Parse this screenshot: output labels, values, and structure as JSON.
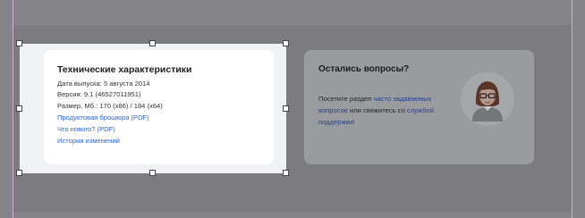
{
  "specs": {
    "title": "Технические характеристики",
    "release_date": "Дата выпуска: 5 августа 2014",
    "version": "Версия: 9.1 (46527011951)",
    "size": "Размер, Мб.: 170 (x86) / 184 (x64)",
    "links": {
      "brochure": "Продуктовая брошюра (PDF)",
      "whats_new": "Что нового? (PDF)",
      "changelog": "История изменений"
    }
  },
  "help": {
    "title": "Остались вопросы?",
    "text_1": "Посетите раздел",
    "faq_link": "часто задаваемых вопросов",
    "text_2": "или свяжитесь со",
    "support_link": "службой поддержки",
    "text_end": "!"
  },
  "colors": {
    "link": "#2b66d1",
    "overlay": "#858589",
    "card": "#ffffff"
  }
}
